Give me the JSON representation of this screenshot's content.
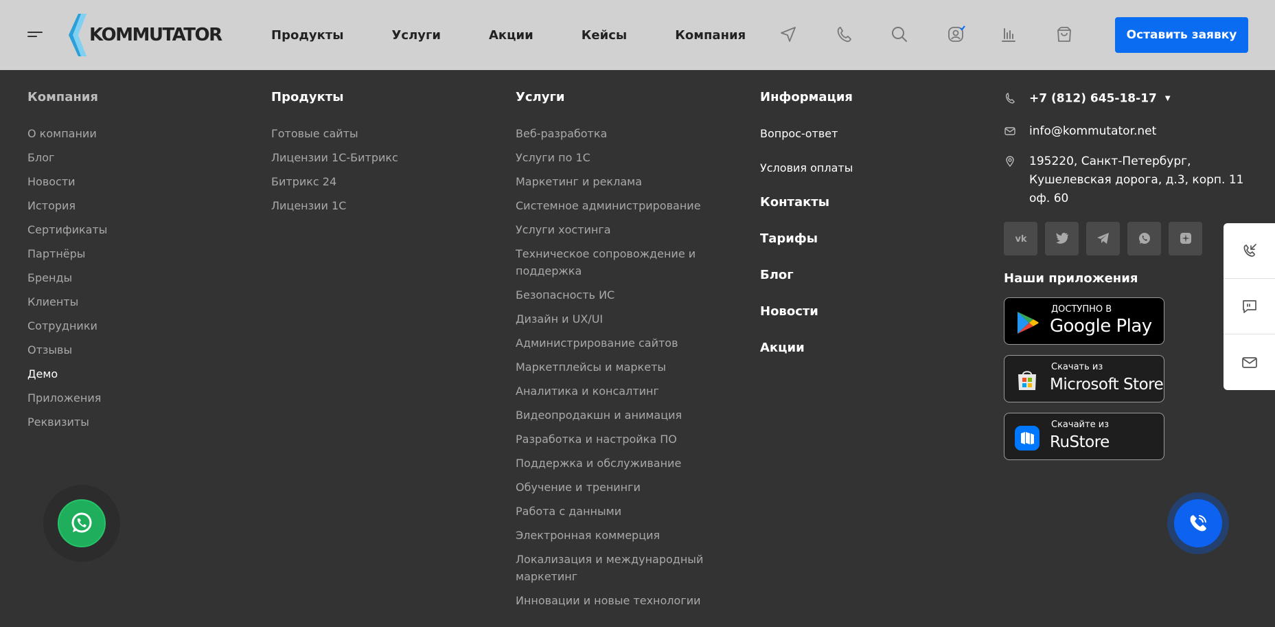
{
  "header": {
    "logo_text": "KOMMUTATOR",
    "nav": [
      "Продукты",
      "Услуги",
      "Акции",
      "Кейсы",
      "Компания"
    ],
    "cta_label": "Оставить заявку",
    "icons": [
      "send-icon",
      "phone-icon",
      "search-icon",
      "user-icon",
      "chart-icon",
      "bag-icon"
    ]
  },
  "columns": {
    "company": {
      "title": "Компания",
      "items": [
        "О компании",
        "Блог",
        "Новости",
        "История",
        "Сертификаты",
        "Партнёры",
        "Бренды",
        "Клиенты",
        "Сотрудники",
        "Отзывы",
        "Демо",
        "Приложения",
        "Реквизиты"
      ],
      "active": "Демо"
    },
    "products": {
      "title": "Продукты",
      "items": [
        "Готовые сайты",
        "Лицензии 1С-Битрикс",
        "Битрикс 24",
        "Лицензии 1С"
      ]
    },
    "services": {
      "title": "Услуги",
      "items": [
        "Веб-разработка",
        "Услуги по 1С",
        "Маркетинг и реклама",
        "Системное администрирование",
        "Услуги хостинга",
        "Техническое сопровождение и поддержка",
        "Безопасность ИС",
        "Дизайн и UX/UI",
        "Администрирование сайтов",
        "Маркетплейсы и маркеты",
        "Аналитика и консалтинг",
        "Видеопродакшн и анимация",
        "Разработка и настройка ПО",
        "Поддержка и обслуживание",
        "Обучение и тренинги",
        "Работа с данными",
        "Электронная коммерция",
        "Локализация и международный маркетинг",
        "Инновации и новые технологии"
      ]
    },
    "info": {
      "title": "Информация",
      "small_items": [
        "Вопрос-ответ",
        "Условия оплаты"
      ],
      "big_items": [
        "Контакты",
        "Тарифы",
        "Блог",
        "Новости",
        "Акции"
      ]
    }
  },
  "contacts": {
    "phone": "+7 (812) 645-18-17",
    "email": "info@kommutator.net",
    "address_line1": "195220, Санкт-Петербург,",
    "address_line2": "Кушелевская дорога, д.3, корп. 11",
    "address_line3": "оф. 60",
    "socials": [
      "vk-icon",
      "twitter-icon",
      "telegram-icon",
      "whatsapp-icon",
      "other-social-icon"
    ],
    "apps_title": "Наши приложения",
    "stores": {
      "google_small": "ДОСТУПНО В",
      "google_big": "Google Play",
      "ms_small": "Скачать из",
      "ms_big": "Microsoft Store",
      "ru_small": "Скачайте из",
      "ru_big": "RuStore"
    }
  },
  "colors": {
    "accent": "#0a6cf0",
    "header_bg": "#d1d1d1",
    "footer_bg": "#333333",
    "whatsapp": "#1fae5b"
  }
}
